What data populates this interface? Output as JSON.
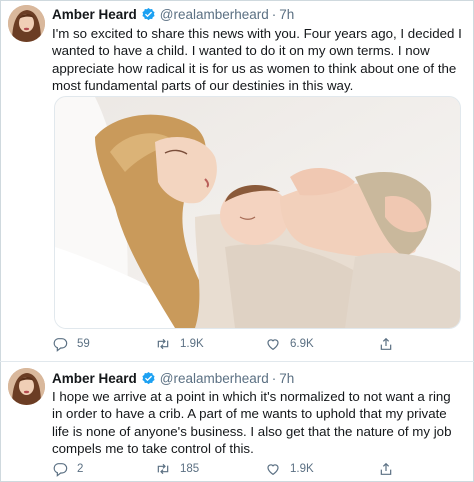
{
  "tweets": [
    {
      "author_name": "Amber Heard",
      "handle": "@realamberheard",
      "separator": "·",
      "time": "7h",
      "text": "I'm so excited to share this news with you. Four years ago, I decided I wanted to have a child. I wanted to do it on my own terms. I now appreciate how radical it is for us as women to think about one of the most fundamental parts of our destinies in this way.",
      "has_photo": true,
      "replies": "59",
      "retweets": "1.9K",
      "likes": "6.9K"
    },
    {
      "author_name": "Amber Heard",
      "handle": "@realamberheard",
      "separator": "·",
      "time": "7h",
      "text": "I hope we arrive at a point in which it's normalized to not want a ring in order to have a crib. A part of me wants to uphold that my private life is none of anyone's business. I also get that the nature of my job compels me to take control of this.",
      "has_photo": false,
      "replies": "2",
      "retweets": "185",
      "likes": "1.9K"
    }
  ],
  "icons": {
    "reply": "reply-icon",
    "retweet": "retweet-icon",
    "like": "heart-icon",
    "share": "share-icon",
    "verified": "verified-badge-icon"
  },
  "colors": {
    "text": "#14171a",
    "secondary": "#5b7083",
    "verified": "#1da1f2",
    "divider": "#e1e8ed"
  }
}
